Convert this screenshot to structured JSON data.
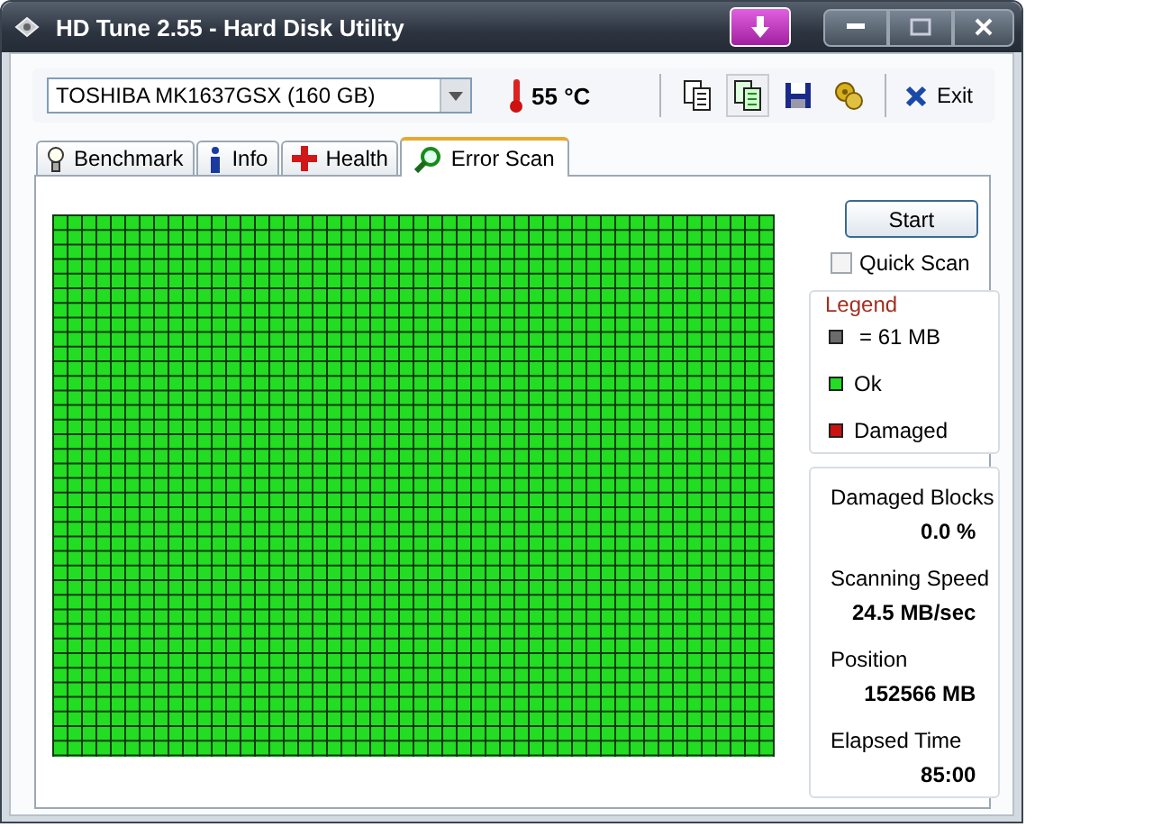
{
  "window": {
    "title": "HD Tune 2.55 - Hard Disk Utility"
  },
  "drive": {
    "value": "TOSHIBA MK1637GSX (160 GB)"
  },
  "temperature": "55 °C",
  "toolbar": {
    "exit_label": "Exit"
  },
  "tabs": [
    {
      "label": "Benchmark",
      "selected": false
    },
    {
      "label": "Info",
      "selected": false
    },
    {
      "label": "Health",
      "selected": false
    },
    {
      "label": "Error Scan",
      "selected": true
    }
  ],
  "error_scan": {
    "start_button": "Start",
    "quick_scan": {
      "label": "Quick Scan",
      "checked": false
    },
    "legend": {
      "title": "Legend",
      "items": [
        {
          "kind": "size",
          "label": "= 61 MB",
          "color": "#6b6b6b"
        },
        {
          "kind": "ok",
          "label": "Ok",
          "color": "#22dd22"
        },
        {
          "kind": "damaged",
          "label": "Damaged",
          "color": "#cc1111"
        }
      ]
    },
    "stats": [
      {
        "label": "Damaged Blocks",
        "value": "0.0 %"
      },
      {
        "label": "Scanning Speed",
        "value": "24.5 MB/sec"
      },
      {
        "label": "Position",
        "value": "152566 MB"
      },
      {
        "label": "Elapsed Time",
        "value": "85:00"
      }
    ]
  }
}
